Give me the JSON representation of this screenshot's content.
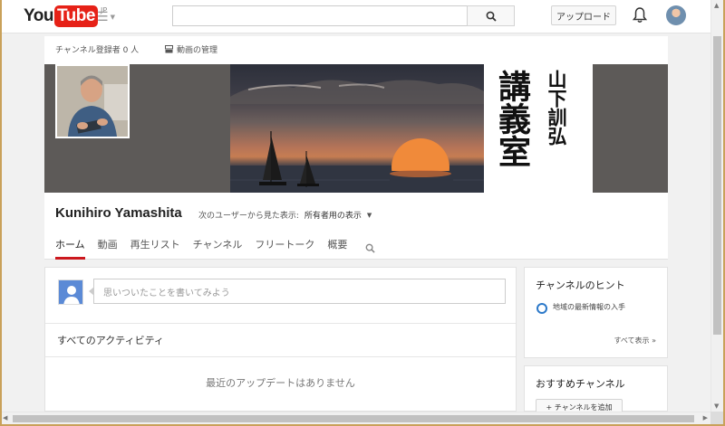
{
  "masthead": {
    "logo_you": "You",
    "logo_tube": "Tube",
    "logo_region": "JP",
    "search_value": "",
    "upload_label": "アップロード"
  },
  "channel": {
    "subscribers_text": "チャンネル登録者 0 人",
    "manage_videos_label": "動画の管理",
    "banner_title_big": "講義室",
    "banner_title_small": "山下訓弘",
    "name": "Kunihiro Yamashita",
    "view_as_label": "次のユーザーから見た表示:",
    "view_as_value": "所有者用の表示",
    "tabs": [
      {
        "label": "ホーム",
        "active": true
      },
      {
        "label": "動画"
      },
      {
        "label": "再生リスト"
      },
      {
        "label": "チャンネル"
      },
      {
        "label": "フリートーク"
      },
      {
        "label": "概要"
      }
    ]
  },
  "feed": {
    "post_placeholder": "思いついたことを書いてみよう",
    "activity_header": "すべてのアクティビティ",
    "no_updates": "最近のアップデートはありません"
  },
  "hints": {
    "title": "チャンネルのヒント",
    "item": "地域の最新情報の入手",
    "show_all": "すべて表示 »"
  },
  "recommended": {
    "title": "おすすめチャンネル",
    "add_button": "+ チャンネルを追加"
  },
  "colors": {
    "brand_red": "#e62117",
    "tab_active": "#cc181e",
    "hint_accent": "#2c79c9",
    "banner_bg": "#5d5a58"
  }
}
